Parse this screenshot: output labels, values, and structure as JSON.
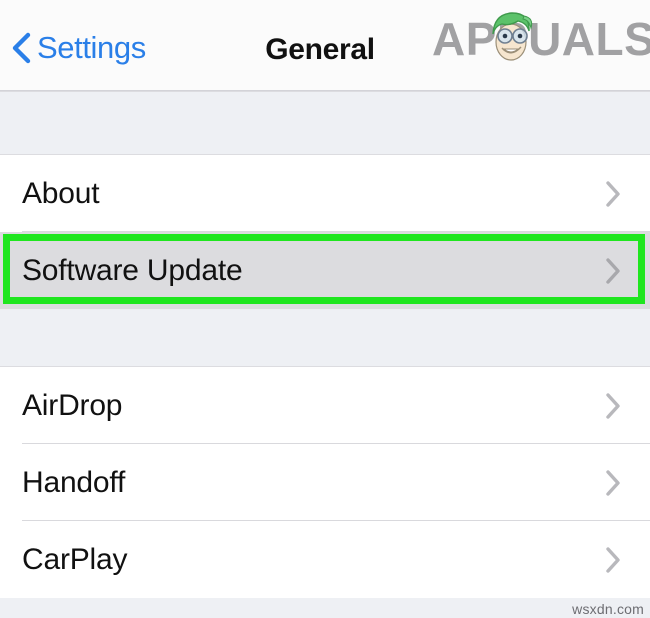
{
  "navbar": {
    "back_label": "Settings",
    "back_icon": "chevron-left-icon",
    "title": "General"
  },
  "watermark": {
    "logo_text": "APPUALS",
    "logo_face_icon": "cartoon-character-icon",
    "site": "wsxdn.com"
  },
  "colors": {
    "accent_blue": "#2a7fe8",
    "highlight_green": "#1fe61f",
    "selected_row_bg": "#dcdcdf",
    "section_gap_bg": "#eef0f4",
    "chevron_grey": "#b8b8bc",
    "logo_grey": "#9a9a9c"
  },
  "sections": [
    {
      "name": "section-one",
      "rows": [
        {
          "label": "About",
          "chevron": "chevron-right-icon",
          "selected": false
        },
        {
          "label": "Software Update",
          "chevron": "chevron-right-icon",
          "selected": true
        }
      ]
    },
    {
      "name": "section-two",
      "rows": [
        {
          "label": "AirDrop",
          "chevron": "chevron-right-icon",
          "selected": false
        },
        {
          "label": "Handoff",
          "chevron": "chevron-right-icon",
          "selected": false
        },
        {
          "label": "CarPlay",
          "chevron": "chevron-right-icon",
          "selected": false
        }
      ]
    }
  ],
  "callout": {
    "target_row_label": "Software Update",
    "border_color": "#1fe61f"
  }
}
